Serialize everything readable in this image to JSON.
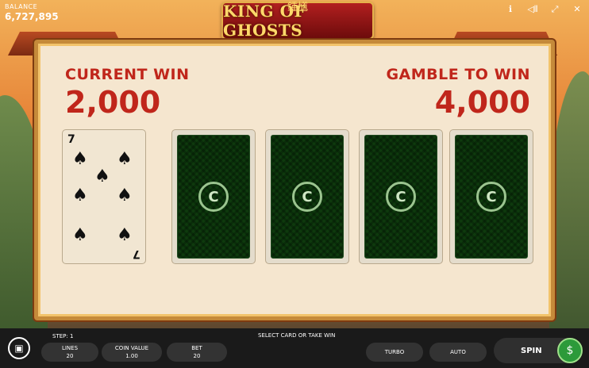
{
  "balance": {
    "label": "BALANCE",
    "value": "6,727,895"
  },
  "logo": {
    "chinese": "鍾馗",
    "title": "KING OF GHOSTS"
  },
  "top_icons": [
    "info-icon",
    "sound-icon",
    "fullscreen-icon",
    "close-icon"
  ],
  "panel": {
    "current_win_label": "CURRENT WIN",
    "current_win_value": "2,000",
    "gamble_label": "GAMBLE TO WIN",
    "gamble_value": "4,000",
    "revealed_card": {
      "rank": "7",
      "suit": "spades"
    },
    "hidden_cards": 4
  },
  "bottom": {
    "step": "STEP: 1",
    "message": "SELECT CARD OR TAKE WIN",
    "lines_label": "LINES",
    "lines_value": "20",
    "coin_label": "COIN VALUE",
    "coin_value": "1.00",
    "bet_label": "BET",
    "bet_value": "20",
    "turbo": "TURBO",
    "auto": "AUTO",
    "spin": "SPIN"
  }
}
